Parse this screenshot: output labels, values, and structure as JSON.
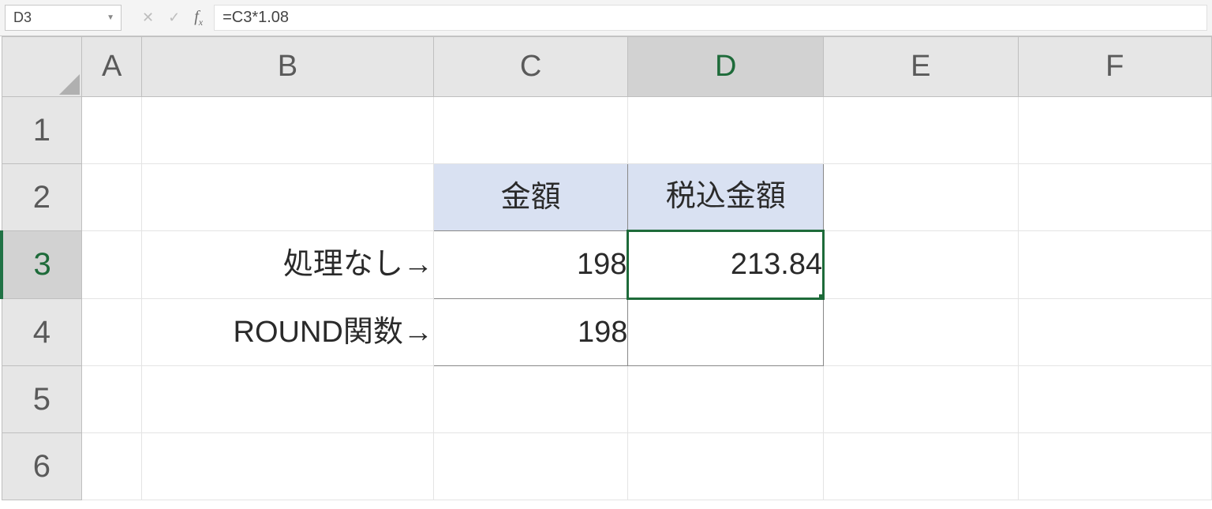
{
  "formula_bar": {
    "name_box": "D3",
    "cancel_icon": "✕",
    "enter_icon": "✓",
    "fx_label": "fx",
    "formula": "=C3*1.08"
  },
  "columns": [
    "A",
    "B",
    "C",
    "D",
    "E",
    "F"
  ],
  "rows": [
    "1",
    "2",
    "3",
    "4",
    "5",
    "6"
  ],
  "selected_col": "D",
  "selected_row": "3",
  "cells": {
    "B3": "処理なし→",
    "B4": "ROUND関数→",
    "C2": "金額",
    "D2": "税込金額",
    "C3": "198",
    "D3": "213.84",
    "C4": "198",
    "D4": ""
  }
}
